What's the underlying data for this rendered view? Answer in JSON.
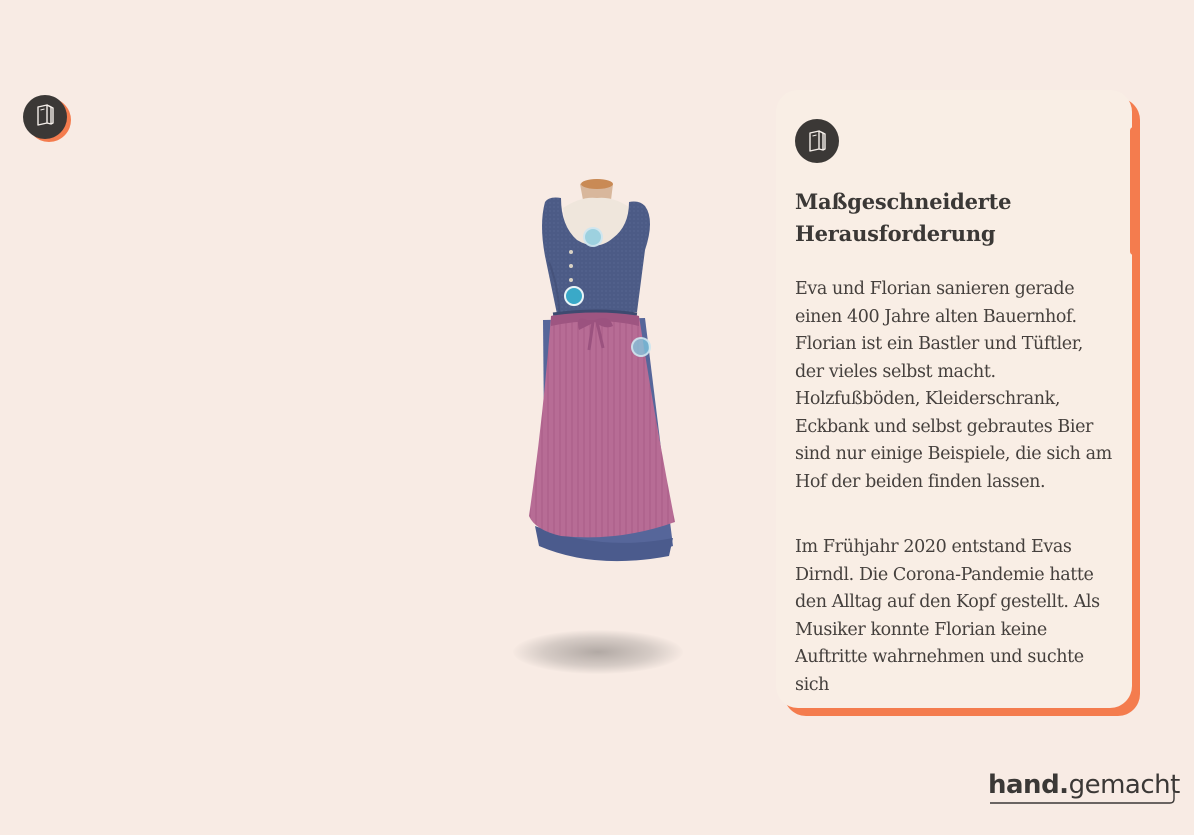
{
  "story_button": {
    "icon": "book-icon"
  },
  "product": {
    "name": "dirndl-dress",
    "hotspots": [
      {
        "id": "bodice-neckline"
      },
      {
        "id": "bodice-buttons"
      },
      {
        "id": "apron-bow"
      }
    ]
  },
  "panel": {
    "icon": "book-icon",
    "title_line1": "Maßgeschneiderte",
    "title_line2": "Herausforderung",
    "paragraphs": [
      "Eva und Florian sanieren gerade einen 400 Jahre alten Bauernhof. Florian ist ein Bastler und Tüftler, der vieles selbst macht. Holzfußböden, Kleiderschrank, Eckbank und selbst gebrautes Bier sind nur einige Beispiele, die sich am Hof der beiden finden lassen.",
      "Im Frühjahr 2020 entstand Evas Dirndl. Die Corona-Pandemie hatte den Alltag auf den Kopf gestellt. Als Musiker konnte Florian keine Auftritte wahrnehmen und suchte sich"
    ]
  },
  "brand": {
    "bold": "hand.",
    "regular": "gemacht"
  },
  "colors": {
    "background": "#f8ebe4",
    "accent": "#f47c4e",
    "dark": "#3b3836",
    "hotspot": "#3aa9c8"
  }
}
